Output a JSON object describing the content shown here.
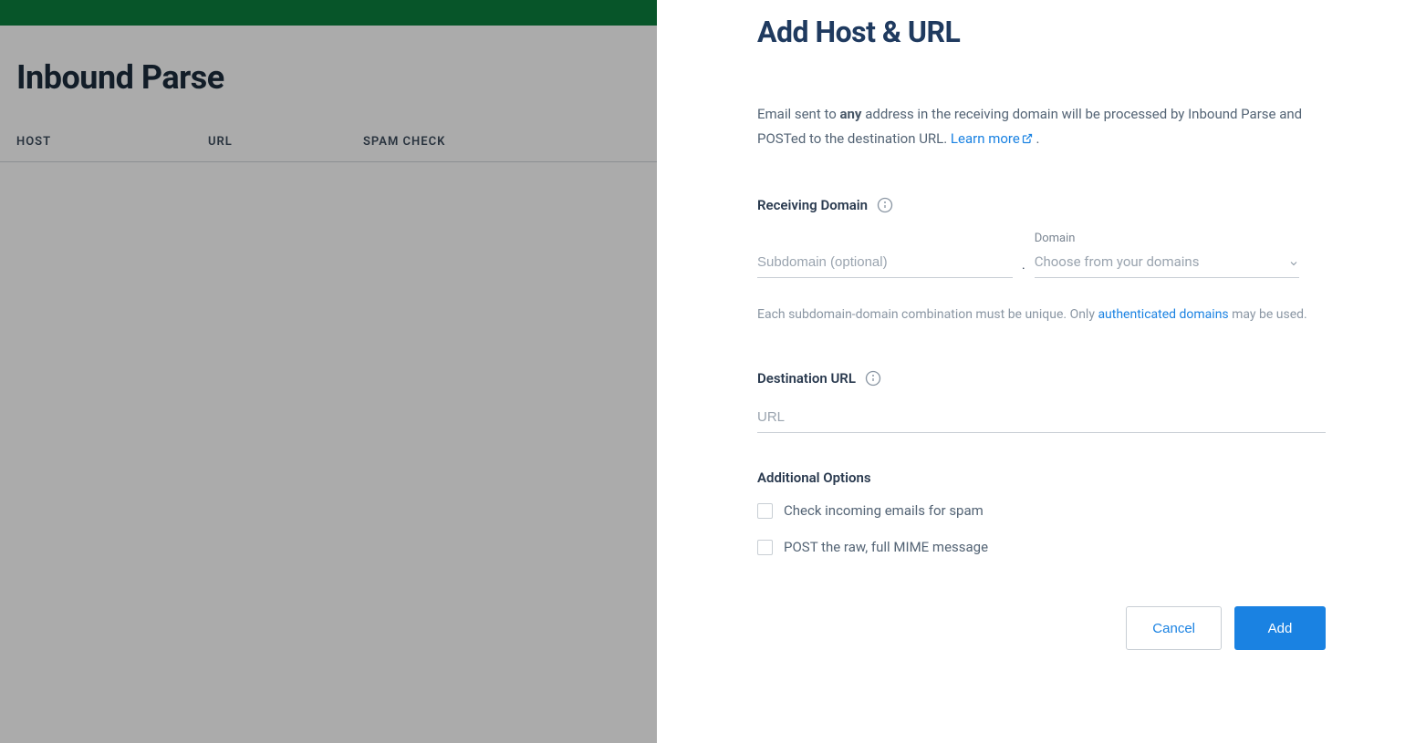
{
  "main": {
    "title": "Inbound Parse",
    "columns": {
      "host": "HOST",
      "url": "URL",
      "spam": "SPAM CHECK"
    }
  },
  "panel": {
    "title": "Add Host & URL",
    "intro_pre": "Email sent to ",
    "intro_bold": "any",
    "intro_post": " address in the receiving domain will be processed by Inbound Parse and POSTed to the destination URL. ",
    "learn_more": "Learn more",
    "intro_period": " .",
    "receiving_domain_heading": "Receiving Domain",
    "subdomain_placeholder": "Subdomain (optional)",
    "domain_label": "Domain",
    "domain_placeholder": "Choose from your domains",
    "unique_pre": "Each subdomain-domain combination must be unique. Only ",
    "auth_domains_link": "authenticated domains",
    "unique_post": " may be used.",
    "destination_url_heading": "Destination URL",
    "url_placeholder": "URL",
    "additional_options_heading": "Additional Options",
    "option_spam": "Check incoming emails for spam",
    "option_raw": "POST the raw, full MIME message",
    "cancel": "Cancel",
    "add": "Add"
  }
}
